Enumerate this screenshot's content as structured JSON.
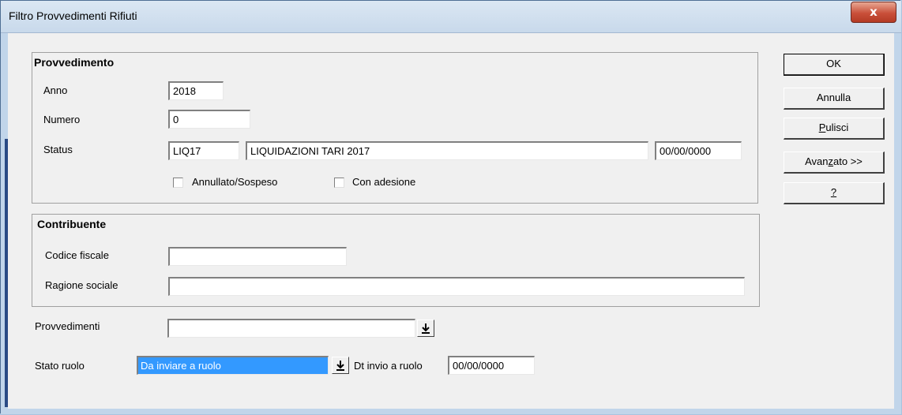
{
  "window": {
    "title": "Filtro Provvedimenti Rifiuti",
    "close_glyph": "x"
  },
  "provvedimento": {
    "title": "Provvedimento",
    "anno_label": "Anno",
    "anno_value": "2018",
    "numero_label": "Numero",
    "numero_value": "0",
    "status_label": "Status",
    "status_code": "LIQ17",
    "status_desc": "LIQUIDAZIONI TARI 2017",
    "status_date": "00/00/0000",
    "annullato_label": "Annullato/Sospeso",
    "adesione_label": "Con adesione"
  },
  "contribuente": {
    "title": "Contribuente",
    "codice_label": "Codice fiscale",
    "codice_value": "",
    "ragione_label": "Ragione sociale",
    "ragione_value": ""
  },
  "provvedimenti": {
    "label": "Provvedimenti",
    "value": ""
  },
  "stato_ruolo": {
    "label": "Stato ruolo",
    "value": "Da inviare a ruolo"
  },
  "dt_invio": {
    "label": "Dt invio a ruolo",
    "value": "00/00/0000"
  },
  "buttons": {
    "ok": "OK",
    "annulla": "Annulla",
    "pulisci_u": "P",
    "pulisci_rest": "ulisci",
    "avanzato_pre": "Avan",
    "avanzato_u": "z",
    "avanzato_post": "ato >>",
    "help": "?"
  },
  "icons": {
    "close": "close-icon",
    "dropdown": "arrow-down-bar-icon"
  }
}
